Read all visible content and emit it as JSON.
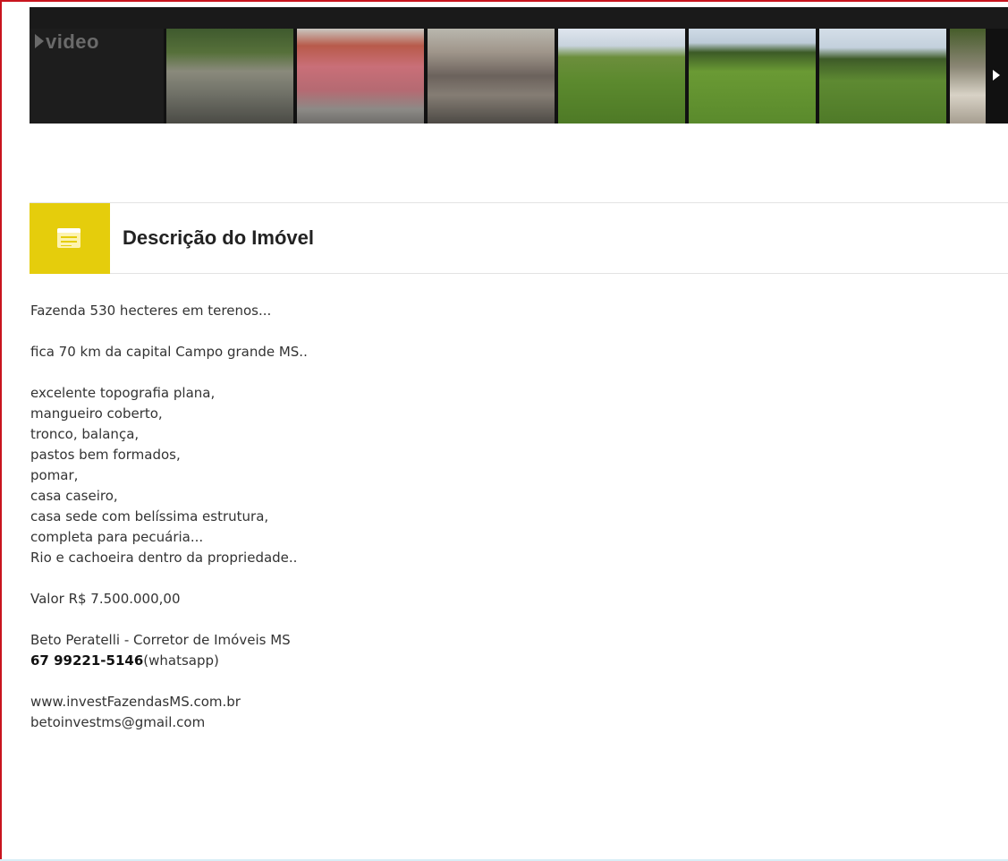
{
  "gallery": {
    "video_label": "video",
    "thumbnails": [
      {
        "icon": "river-photo"
      },
      {
        "icon": "house-porch-photo"
      },
      {
        "icon": "patio-table-photo"
      },
      {
        "icon": "pasture-photo"
      },
      {
        "icon": "pasture-photo"
      },
      {
        "icon": "pasture-tree-photo"
      },
      {
        "icon": "waterfall-photo"
      }
    ],
    "next_icon": "play-arrow-icon"
  },
  "section": {
    "title": "Descrição do Imóvel",
    "icon": "document-list-icon",
    "accent_color": "#e5cd0c"
  },
  "description": {
    "intro": "Fazenda 530 hecteres em terenos...",
    "location": "fica 70 km da capital Campo grande MS..",
    "features": [
      "excelente topografia plana,",
      "mangueiro coberto,",
      "tronco, balança,",
      "pastos bem formados,",
      "pomar,",
      "casa caseiro,",
      "casa sede com belíssima estrutura,",
      "completa para pecuária...",
      "Rio e cachoeira dentro da propriedade.."
    ],
    "price": "Valor R$ 7.500.000,00",
    "agent": "Beto Peratelli - Corretor de Imóveis MS",
    "phone": "67 99221-5146",
    "phone_suffix": "(whatsapp)",
    "website": "www.investFazendasMS.com.br",
    "email": "betoinvestms@gmail.com"
  }
}
